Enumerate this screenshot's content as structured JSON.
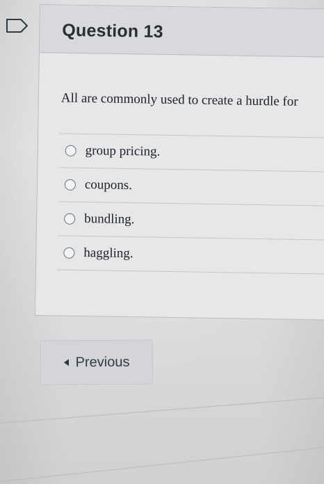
{
  "question": {
    "title": "Question 13",
    "text": "All are commonly used to create a hurdle for",
    "options": [
      {
        "label": "group pricing."
      },
      {
        "label": "coupons."
      },
      {
        "label": "bundling."
      },
      {
        "label": "haggling."
      }
    ]
  },
  "navigation": {
    "previous_label": "Previous"
  },
  "icons": {
    "flag": "flag-icon",
    "previous_arrow": "triangle-left-icon"
  }
}
